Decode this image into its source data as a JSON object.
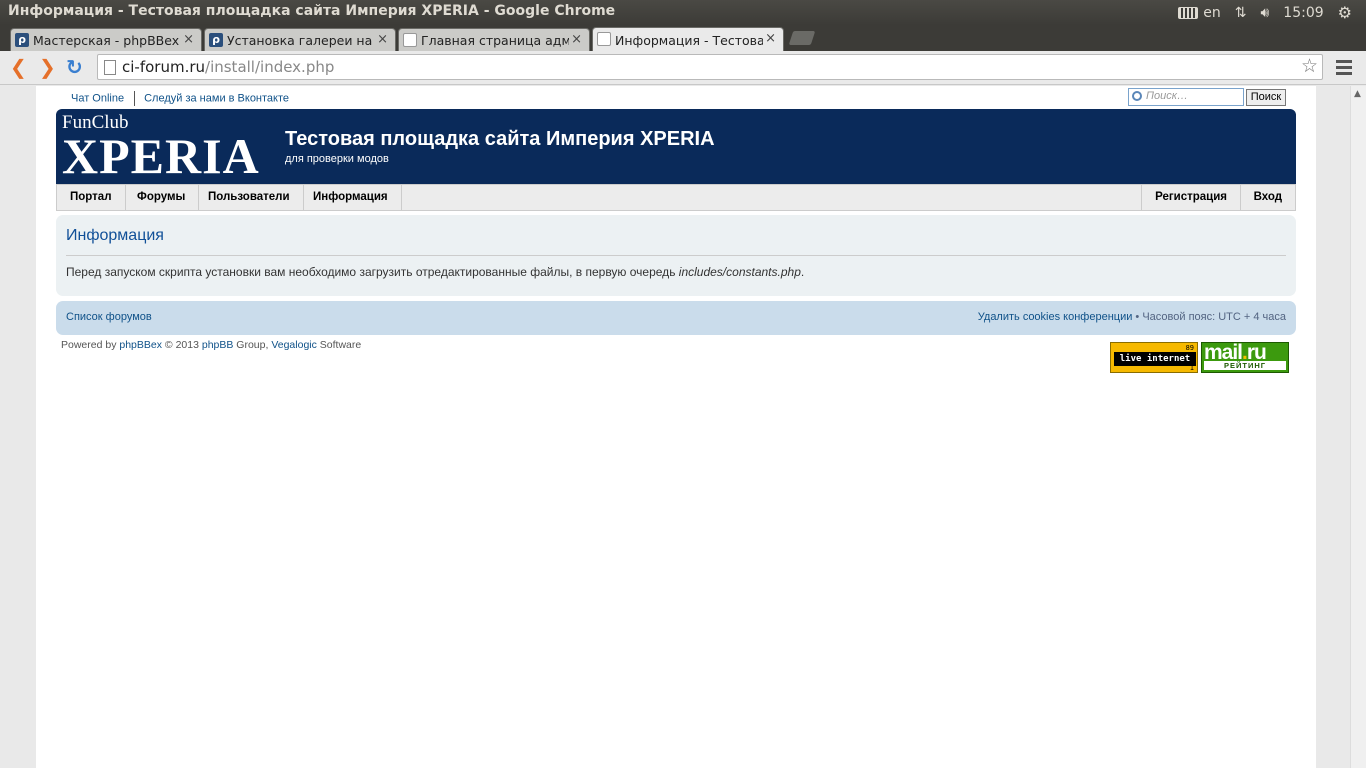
{
  "window": {
    "title": "Информация - Тестовая площадка сайта Империя XPERIA - Google Chrome"
  },
  "tray": {
    "lang": "en",
    "clock": "15:09",
    "icons": [
      "keyboard-icon",
      "network-icon",
      "volume-icon",
      "power-icon"
    ]
  },
  "tabs": [
    {
      "label": "Мастерская - phpBBex",
      "favicon": "phpbb-icon"
    },
    {
      "label": "Установка галереи на ph",
      "favicon": "phpbb-icon"
    },
    {
      "label": "Главная страница админ",
      "favicon": "page-icon"
    },
    {
      "label": "Информация - Тестовая",
      "favicon": "page-icon",
      "active": true
    }
  ],
  "tab_close": "×",
  "omnibox": {
    "host": "ci-forum.ru",
    "path": "/install/index.php"
  },
  "forum": {
    "top_links": [
      "Чат Online",
      "Следуй за нами в Вконтакте"
    ],
    "search": {
      "placeholder": "Поиск…",
      "button": "Поиск"
    },
    "logo": {
      "line1": "FunClub",
      "line2": "XPERIA"
    },
    "site_name": "Тестовая площадка сайта Империя XPERIA",
    "site_desc": "для проверки модов",
    "nav_left": [
      "Портал",
      "Форумы",
      "Пользователи",
      "Информация"
    ],
    "nav_right": [
      "Регистрация",
      "Вход"
    ],
    "info": {
      "heading": "Информация",
      "message_prefix": "Перед запуском скрипта установки вам необходимо загрузить отредактированные файлы, в первую очередь ",
      "message_file": "includes/constants.php",
      "message_suffix": "."
    },
    "footer": {
      "forum_index": "Список форумов",
      "delete_cookies": "Удалить cookies конференции",
      "bullet": " • ",
      "timezone": "Часовой пояс: UTC + 4 часа"
    },
    "copyright": {
      "powered": "Powered by ",
      "phpbbex": "phpBBex",
      "mid": " © 2013 ",
      "phpbb": "phpBB",
      "group": " Group, ",
      "vegalogic": "Vegalogic",
      "software": " Software"
    },
    "counters": {
      "liveinternet": {
        "label": "live internet",
        "n1": "89",
        "n2": "1"
      },
      "mailru": {
        "brand_a": "mail",
        "dot": ".",
        "brand_b": "ru",
        "rating": "РЕЙТИНГ"
      }
    }
  }
}
